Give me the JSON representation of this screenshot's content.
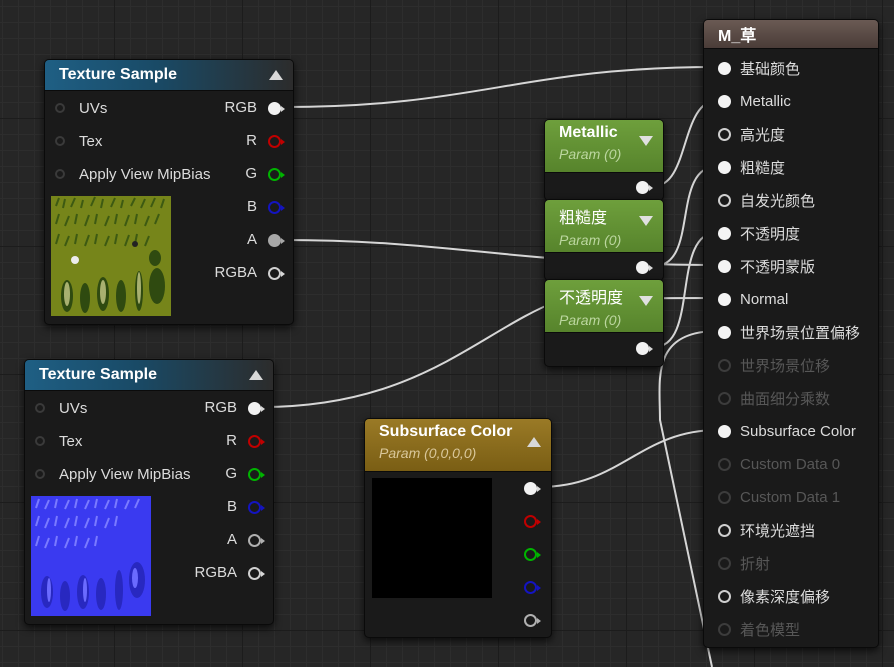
{
  "colors": {
    "texture_header": "#1f5f84",
    "param_header": "#6e9f3c",
    "subsurface_header": "#8a6d1e",
    "material_header": "#5a4a44",
    "wire": "#dcdcdc"
  },
  "texture_sample_1": {
    "title": "Texture Sample",
    "inputs": [
      "UVs",
      "Tex",
      "Apply View MipBias"
    ],
    "outputs": [
      "RGB",
      "R",
      "G",
      "B",
      "A",
      "RGBA"
    ],
    "preview": "grass-diffuse-texture"
  },
  "texture_sample_2": {
    "title": "Texture Sample",
    "inputs": [
      "UVs",
      "Tex",
      "Apply View MipBias"
    ],
    "outputs": [
      "RGB",
      "R",
      "G",
      "B",
      "A",
      "RGBA"
    ],
    "preview": "grass-normal-texture"
  },
  "param_metallic": {
    "title": "Metallic",
    "subtitle": "Param (0)"
  },
  "param_roughness": {
    "title": "粗糙度",
    "subtitle": "Param (0)"
  },
  "param_opacity": {
    "title": "不透明度",
    "subtitle": "Param (0)"
  },
  "subsurface": {
    "title": "Subsurface Color",
    "subtitle": "Param (0,0,0,0)",
    "preview_color": "#000000"
  },
  "material": {
    "title": "M_草",
    "pins": [
      {
        "label": "基础颜色",
        "state": "connected"
      },
      {
        "label": "Metallic",
        "state": "connected"
      },
      {
        "label": "高光度",
        "state": "open"
      },
      {
        "label": "粗糙度",
        "state": "connected"
      },
      {
        "label": "自发光颜色",
        "state": "open"
      },
      {
        "label": "不透明度",
        "state": "connected"
      },
      {
        "label": "不透明蒙版",
        "state": "connected"
      },
      {
        "label": "Normal",
        "state": "connected"
      },
      {
        "label": "世界场景位置偏移",
        "state": "connected"
      },
      {
        "label": "世界场景位移",
        "state": "disabled"
      },
      {
        "label": "曲面细分乘数",
        "state": "disabled"
      },
      {
        "label": "Subsurface Color",
        "state": "connected"
      },
      {
        "label": "Custom Data 0",
        "state": "disabled"
      },
      {
        "label": "Custom Data 1",
        "state": "disabled"
      },
      {
        "label": "环境光遮挡",
        "state": "open"
      },
      {
        "label": "折射",
        "state": "disabled"
      },
      {
        "label": "像素深度偏移",
        "state": "open"
      },
      {
        "label": "着色模型",
        "state": "disabled"
      }
    ]
  }
}
